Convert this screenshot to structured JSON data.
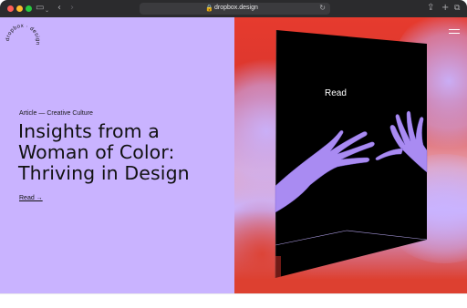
{
  "browser": {
    "url": "dropbox.design",
    "icons": {
      "sidebar": "sidebar-icon",
      "back": "chevron-left-icon",
      "forward": "chevron-right-icon",
      "lock": "lock-icon",
      "reload": "reload-icon",
      "share": "share-icon",
      "new_tab": "plus-icon",
      "tabs": "tab-overview-icon"
    },
    "glyphs": {
      "sidebar": "▭",
      "sidebar_caret": "⌄",
      "back": "‹",
      "forward": "›",
      "lock": "🔒",
      "reload": "↻",
      "share": "⇪",
      "new_tab": "+",
      "tabs": "⧉"
    }
  },
  "logo": {
    "text": "dropbox · design"
  },
  "article": {
    "kicker": "Article — Creative Culture",
    "headline_lines": [
      "Insights from a",
      "Woman of Color:",
      "Thriving in Design"
    ],
    "read_link": "Read →"
  },
  "hero": {
    "label": "Read"
  },
  "colors": {
    "accent_lavender": "#c9b3ff",
    "accent_red": "#dd3a2c",
    "chrome": "#2b2b2d",
    "hands": "#a98bf2"
  }
}
